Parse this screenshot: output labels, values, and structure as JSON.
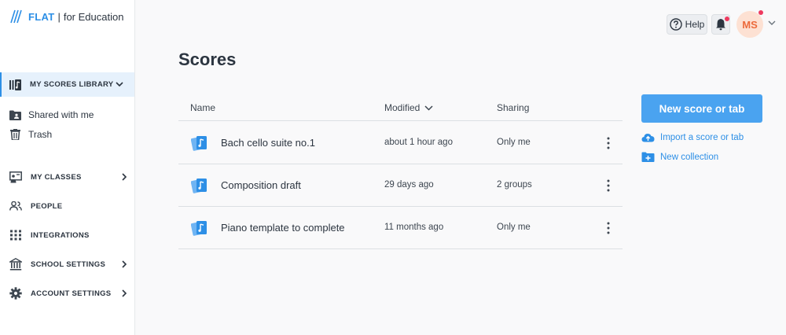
{
  "brand": {
    "name": "FLAT",
    "separator": "|",
    "suffix": "for Education"
  },
  "sidebar": {
    "library": {
      "label": "MY SCORES LIBRARY"
    },
    "sub_items": [
      {
        "label": "Shared with me",
        "icon": "shared-folder-icon"
      },
      {
        "label": "Trash",
        "icon": "trash-icon"
      }
    ],
    "nav": [
      {
        "label": "MY CLASSES",
        "icon": "classes-icon",
        "chevron": true
      },
      {
        "label": "PEOPLE",
        "icon": "people-icon",
        "chevron": false
      },
      {
        "label": "INTEGRATIONS",
        "icon": "grid-icon",
        "chevron": false
      },
      {
        "label": "SCHOOL SETTINGS",
        "icon": "school-icon",
        "chevron": true
      },
      {
        "label": "ACCOUNT SETTINGS",
        "icon": "gear-icon",
        "chevron": true
      }
    ]
  },
  "topbar": {
    "help_label": "Help",
    "avatar_initials": "MS"
  },
  "main": {
    "title": "Scores",
    "columns": {
      "name": "Name",
      "modified": "Modified",
      "sharing": "Sharing"
    },
    "rows": [
      {
        "name": "Bach cello suite no.1",
        "modified": "about 1 hour ago",
        "sharing": "Only me"
      },
      {
        "name": "Composition draft",
        "modified": "29 days ago",
        "sharing": "2 groups"
      },
      {
        "name": "Piano template to complete",
        "modified": "11 months ago",
        "sharing": "Only me"
      }
    ]
  },
  "actions": {
    "new_score": "New score or tab",
    "import": "Import a score or tab",
    "new_collection": "New collection"
  },
  "colors": {
    "accent": "#2d8fe6",
    "button": "#4aa3f0",
    "notification": "#ee3a5f",
    "avatar_bg": "#fde1d3",
    "avatar_text": "#ec6a3c"
  }
}
